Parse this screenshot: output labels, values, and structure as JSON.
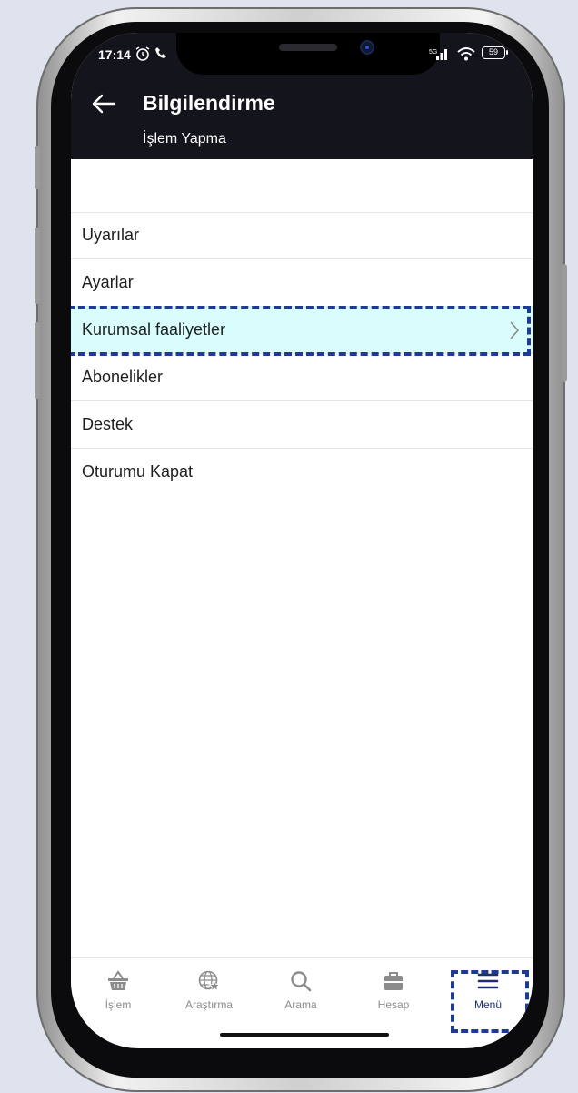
{
  "status_bar": {
    "time": "17:14",
    "battery": "59"
  },
  "header": {
    "title": "Bilgilendirme",
    "subtitle": "İşlem Yapma"
  },
  "menu": {
    "items": [
      {
        "label": "Uyarılar"
      },
      {
        "label": "Ayarlar"
      },
      {
        "label": "Kurumsal faaliyetler",
        "highlighted": true
      },
      {
        "label": "Abonelikler"
      },
      {
        "label": "Destek"
      },
      {
        "label": "Oturumu Kapat"
      }
    ]
  },
  "tabs": [
    {
      "label": "İşlem",
      "icon": "basket-icon"
    },
    {
      "label": "Araştırma",
      "icon": "globe-star-icon"
    },
    {
      "label": "Arama",
      "icon": "search-icon"
    },
    {
      "label": "Hesap",
      "icon": "briefcase-icon"
    },
    {
      "label": "Menü",
      "icon": "hamburger-menu-icon",
      "active": true
    }
  ],
  "colors": {
    "header_bg": "#14141c",
    "highlight_row": "#d8fdfc",
    "annotation_border": "#1f3a93",
    "active_tab": "#1f2d6e",
    "inactive_tab": "#8c8c8c"
  }
}
